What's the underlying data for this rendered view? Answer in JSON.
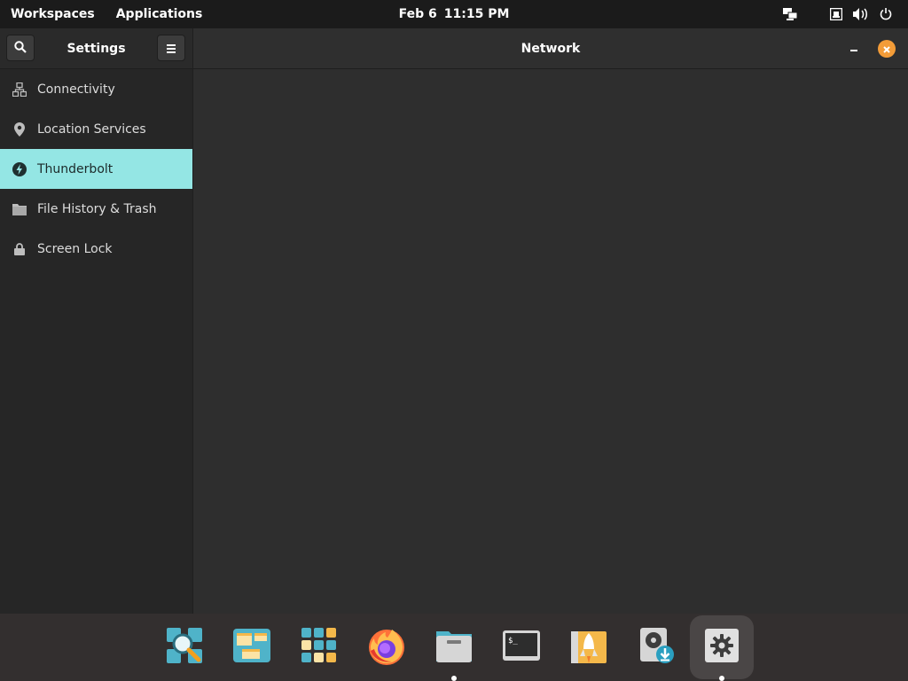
{
  "topbar": {
    "workspaces": "Workspaces",
    "applications": "Applications",
    "date": "Feb 6",
    "time": "11:15 PM"
  },
  "sidebar": {
    "title": "Settings",
    "items": [
      {
        "label": "Connectivity",
        "icon": "network-icon",
        "active": false
      },
      {
        "label": "Location Services",
        "icon": "location-pin-icon",
        "active": false
      },
      {
        "label": "Thunderbolt",
        "icon": "thunderbolt-icon",
        "active": true
      },
      {
        "label": "File History & Trash",
        "icon": "folder-icon",
        "active": false
      },
      {
        "label": "Screen Lock",
        "icon": "lock-icon",
        "active": false
      }
    ]
  },
  "content": {
    "title": "Network"
  },
  "dock": {
    "items": [
      {
        "name": "search-app-icon",
        "running": false
      },
      {
        "name": "workspaces-app-icon",
        "running": false
      },
      {
        "name": "app-grid-icon",
        "running": false
      },
      {
        "name": "firefox-icon",
        "running": false
      },
      {
        "name": "files-icon",
        "running": true
      },
      {
        "name": "terminal-icon",
        "running": false
      },
      {
        "name": "launch-icon",
        "running": false
      },
      {
        "name": "installer-icon",
        "running": false
      },
      {
        "name": "settings-icon",
        "running": true
      }
    ]
  },
  "colors": {
    "accent": "#94e6e4",
    "close": "#f39c38",
    "topbar": "#1b1b1b"
  }
}
